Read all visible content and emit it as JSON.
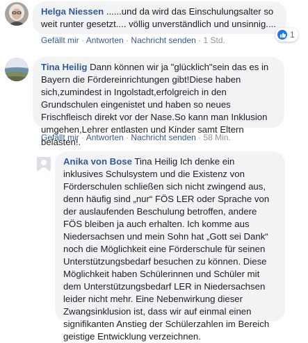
{
  "comments": [
    {
      "author": "Helga Niessen",
      "text": " ......und da wird das Einschulungsalter so weit runter gesetzt.... völlig unverständlich und unsinnig....",
      "like": "Gefällt mir",
      "reply": "Antworten",
      "message": "Nachricht senden",
      "time": "1 Std.",
      "reaction_count": "1"
    },
    {
      "author": "Tina Heilig",
      "text": " Dann können wir ja \"glücklich\"sein das es in Bayern die Fördereinrichtungen gibt!Diese haben sich,zumindest in Ingolstadt,erfolgreich in den Grundschulen eingenistet und haben so neues Frischfleisch direkt vor der Nase.So kann man Inklusion umgehen,Lehrer entlasten und Kinder samt Eltern belasten!.",
      "like": "Gefällt mir",
      "reply": "Antworten",
      "message": "Nachricht senden",
      "time": "58 Min."
    },
    {
      "author": "Anika von Bose",
      "mention": "Tina Heilig",
      "text": " Ich denke ein inklusives Schulsystem und die Existenz von Förderschulen schließen sich nicht zwingend aus, denn häufig sind „nur“ FÖS LER oder Sprache von der auslaufenden Beschulung betroffen, andere FÖS bleiben ja auch erhalten. Ich komme aus Niedersachsen und mein Sohn hat „Gott sei Dank“ noch die Möglichkeit eine Förderschule für seinen Unterstützungsbedarf besuchen zu können. Diese Möglichkeit haben Schülerinnen und Schüler mit dem Unterstützungsbedarf LER in Niedersachsen leider nicht mehr. Eine Nebenwirkung dieser Zwangsinklusion ist, dass wir auf einmal einen signifikanten Anstieg der Schülerzahlen im Bereich geistige Entwicklung verzeichnen."
    }
  ],
  "separator": "·",
  "colors": {
    "link": "#385898",
    "bubble": "#f2f3f5",
    "meta": "#90949c",
    "like_blue": "#1877f2"
  }
}
